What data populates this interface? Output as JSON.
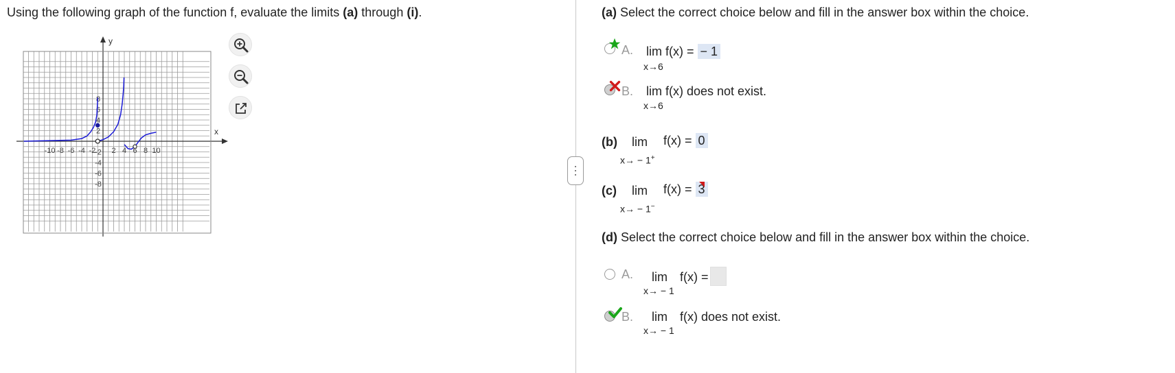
{
  "question": {
    "lead": "Using the following graph of the function f, evaluate the limits ",
    "part_a_ref": "(a)",
    "through": " through ",
    "part_i_ref": "(i)",
    "period": "."
  },
  "graph": {
    "x_axis_label": "x",
    "y_axis_label": "y",
    "x_tick_labels": [
      "-10",
      "-8",
      "-6",
      "-4",
      "-2",
      "2",
      "4",
      "6",
      "8",
      "10"
    ],
    "y_tick_labels": [
      "8",
      "6",
      "4",
      "2",
      "-2",
      "-4",
      "-6",
      "-8"
    ],
    "curve_color": "#1a1ad6"
  },
  "tools": {
    "zoom_in_icon": "zoom-in-icon",
    "zoom_out_icon": "zoom-out-icon",
    "popout_icon": "external-link-icon"
  },
  "part_a": {
    "prompt_label": "(a)",
    "prompt_text": " Select the correct choice below and fill in the answer box within the choice.",
    "choice_a_letter": "A.",
    "choice_a_expr": "lim  f(x) =",
    "choice_a_answer": "− 1",
    "choice_a_sub": "x→6",
    "choice_b_letter": "B.",
    "choice_b_expr": "lim  f(x) does not exist.",
    "choice_b_sub": "x→6"
  },
  "part_b": {
    "label": "(b)",
    "lim": "lim",
    "expr": "f(x) =",
    "answer": "0",
    "sub": "x→ − 1",
    "sup": "+"
  },
  "part_c": {
    "label": "(c)",
    "lim": "lim",
    "expr": "f(x) =",
    "answer": "3",
    "sub": "x→ − 1",
    "sup": "−"
  },
  "part_d": {
    "prompt_label": "(d)",
    "prompt_text": " Select the correct choice below and fill in the answer box within the choice.",
    "choice_a_letter": "A.",
    "choice_a_lim": "lim",
    "choice_a_expr": "f(x) =",
    "choice_a_sub": "x→ − 1",
    "choice_b_letter": "B.",
    "choice_b_lim": "lim",
    "choice_b_expr": "f(x) does not exist.",
    "choice_b_sub": "x→ − 1"
  },
  "colors": {
    "correct_green": "#1aa61a",
    "incorrect_red": "#d11a1a",
    "answer_highlight": "#dde6f4"
  }
}
